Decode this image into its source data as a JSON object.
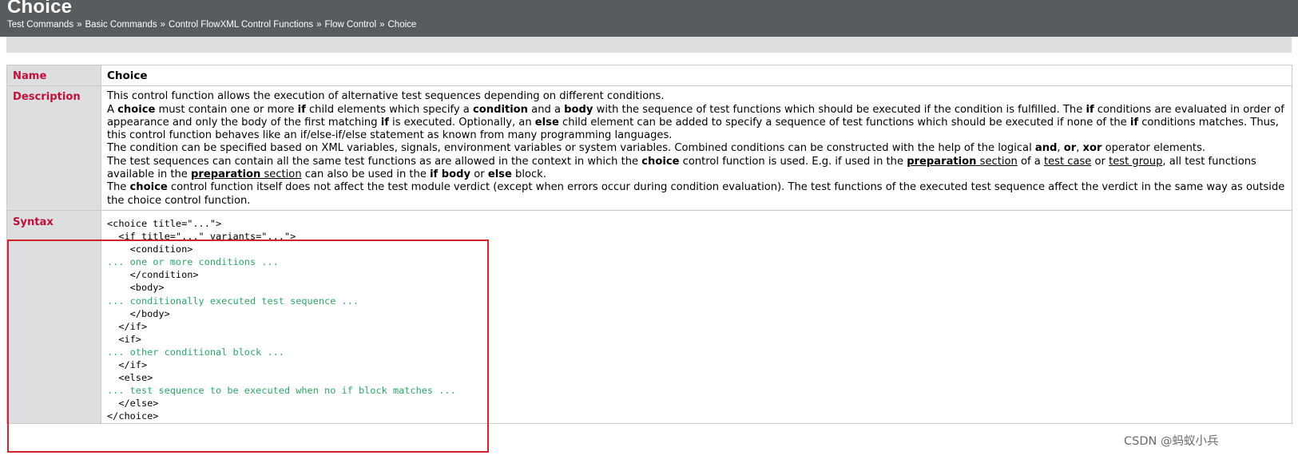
{
  "header": {
    "title": "Choice",
    "breadcrumb": [
      "Test Commands",
      "Basic Commands",
      "Control FlowXML Control Functions",
      "Flow Control",
      "Choice"
    ],
    "separator": "»"
  },
  "table": {
    "name_label": "Name",
    "name_value": "Choice",
    "description_label": "Description",
    "description": [
      [
        {
          "t": "This control function allows the execution of alternative test sequences depending on different conditions."
        }
      ],
      [
        {
          "t": "A "
        },
        {
          "t": "choice",
          "b": true
        },
        {
          "t": " must contain one or more "
        },
        {
          "t": "if",
          "b": true
        },
        {
          "t": " child elements which specify a "
        },
        {
          "t": "condition",
          "b": true
        },
        {
          "t": " and a "
        },
        {
          "t": "body",
          "b": true
        },
        {
          "t": " with the sequence of test functions which should be executed if the condition is fulfilled. The "
        },
        {
          "t": "if",
          "b": true
        },
        {
          "t": " conditions are evaluated in order of appearance and only the body of the first matching "
        },
        {
          "t": "if",
          "b": true
        },
        {
          "t": " is executed. Optionally, an "
        },
        {
          "t": "else",
          "b": true
        },
        {
          "t": " child element can be added to specify a sequence of test functions which should be executed if none of the "
        },
        {
          "t": "if",
          "b": true
        },
        {
          "t": " conditions matches. Thus, this control function behaves like an if/else-if/else statement as known from many programming languages."
        }
      ],
      [
        {
          "t": "The condition can be specified based on XML variables, signals, environment variables or system variables. Combined conditions can be constructed with the help of the logical "
        },
        {
          "t": "and",
          "b": true
        },
        {
          "t": ", "
        },
        {
          "t": "or",
          "b": true
        },
        {
          "t": ", "
        },
        {
          "t": "xor",
          "b": true
        },
        {
          "t": " operator elements."
        }
      ],
      [
        {
          "t": "The test sequences can contain all the same test functions as are allowed in the context in which the "
        },
        {
          "t": "choice",
          "b": true
        },
        {
          "t": " control function is used. E.g. if used in the "
        },
        {
          "t": "preparation",
          "b": true,
          "u": true
        },
        {
          "t": " section",
          "u": true
        },
        {
          "t": " of a "
        },
        {
          "t": "test case",
          "u": true
        },
        {
          "t": " or "
        },
        {
          "t": "test group",
          "u": true
        },
        {
          "t": ", all test functions available in the "
        },
        {
          "t": "preparation",
          "b": true,
          "u": true
        },
        {
          "t": " section",
          "u": true
        },
        {
          "t": " can also be used in the "
        },
        {
          "t": "if body",
          "b": true
        },
        {
          "t": " or "
        },
        {
          "t": "else",
          "b": true
        },
        {
          "t": " block."
        }
      ],
      [
        {
          "t": "The "
        },
        {
          "t": "choice",
          "b": true
        },
        {
          "t": " control function itself does not affect the test module verdict (except when errors occur during condition evaluation). The test functions of the executed test sequence affect the verdict in the same way as outside the choice control function."
        }
      ]
    ],
    "syntax_label": "Syntax",
    "syntax_lines": [
      {
        "text": "<choice title=\"...\">"
      },
      {
        "text": "  <if title=\"...\" variants=\"...\">"
      },
      {
        "text": "    <condition>"
      },
      {
        "text": "... one or more conditions ...",
        "comment": true
      },
      {
        "text": "    </condition>"
      },
      {
        "text": "    <body>"
      },
      {
        "text": "... conditionally executed test sequence ...",
        "comment": true
      },
      {
        "text": "    </body>"
      },
      {
        "text": "  </if>"
      },
      {
        "text": "  <if>"
      },
      {
        "text": "... other conditional block ...",
        "comment": true
      },
      {
        "text": "  </if>"
      },
      {
        "text": "  <else>"
      },
      {
        "text": "... test sequence to be executed when no if block matches ...",
        "comment": true
      },
      {
        "text": "  </else>"
      },
      {
        "text": "</choice>"
      }
    ]
  },
  "watermark": "CSDN @蚂蚁小兵",
  "colors": {
    "header_bg": "#595c5e",
    "label_color": "#c0103a",
    "label_bg": "#dcdedf",
    "comment_color": "#2aa866",
    "highlight_border": "#d2232a"
  }
}
